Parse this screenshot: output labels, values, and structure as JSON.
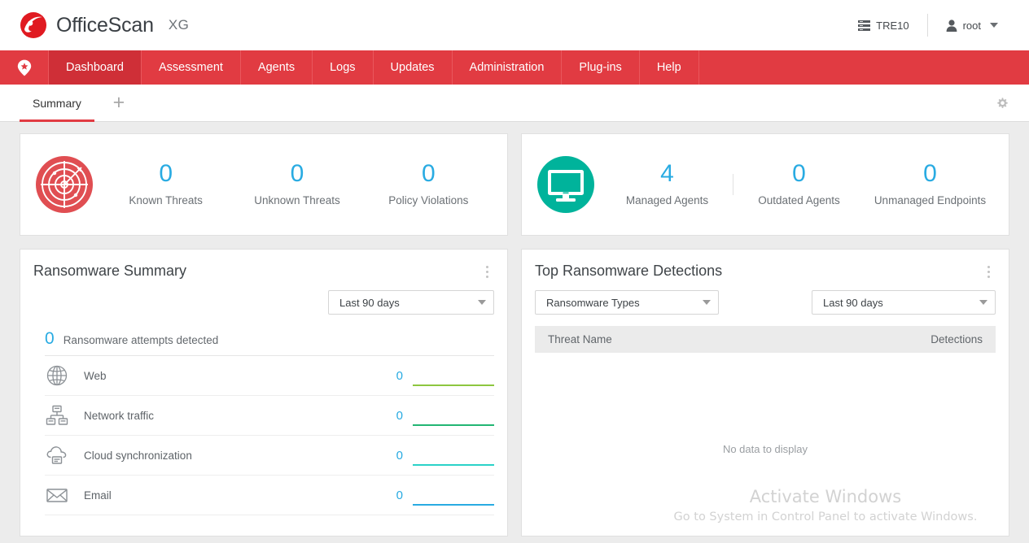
{
  "header": {
    "brand_name": "OfficeScan",
    "brand_suffix": "XG",
    "logo_icon": "trendmicro-swirl-logo",
    "server_icon": "server-stack-icon",
    "server_label": "TRE10",
    "user_icon": "person-icon",
    "user_label": "root",
    "user_caret_icon": "chevron-down-icon"
  },
  "nav": {
    "home_icon": "map-pin-star-icon",
    "items": [
      {
        "label": "Dashboard",
        "active": true
      },
      {
        "label": "Assessment",
        "active": false
      },
      {
        "label": "Agents",
        "active": false
      },
      {
        "label": "Logs",
        "active": false
      },
      {
        "label": "Updates",
        "active": false
      },
      {
        "label": "Administration",
        "active": false
      },
      {
        "label": "Plug-ins",
        "active": false
      },
      {
        "label": "Help",
        "active": false
      }
    ],
    "bg_color": "#e13b42",
    "active_bg_color": "#cf2f37"
  },
  "tabbar": {
    "tabs": [
      {
        "label": "Summary",
        "active": true
      }
    ],
    "add_tab_label": "+",
    "add_tab_icon": "plus-icon",
    "settings_icon": "gear-icon"
  },
  "summary_cards": [
    {
      "badge_icon": "radar-threat-icon",
      "badge_color": "#e04e52",
      "stats": [
        {
          "value": "0",
          "label": "Known Threats",
          "divider_after": false
        },
        {
          "value": "0",
          "label": "Unknown Threats",
          "divider_after": false
        },
        {
          "value": "0",
          "label": "Policy Violations",
          "divider_after": false
        }
      ]
    },
    {
      "badge_icon": "desktop-monitor-icon",
      "badge_color": "#00b39b",
      "stats": [
        {
          "value": "4",
          "label": "Managed Agents",
          "divider_after": true
        },
        {
          "value": "0",
          "label": "Outdated Agents",
          "divider_after": false
        },
        {
          "value": "0",
          "label": "Unmanaged Endpoints",
          "divider_after": false
        }
      ]
    }
  ],
  "ransomware_summary": {
    "title": "Ransomware Summary",
    "menu_icon": "kebab-menu-icon",
    "range_dropdown": {
      "value": "Last 90 days",
      "caret_icon": "caret-down-icon"
    },
    "total_value": "0",
    "total_label": "Ransomware attempts detected",
    "rows": [
      {
        "icon": "globe-icon",
        "label": "Web",
        "value": "0",
        "bar_color": "#8dc63f"
      },
      {
        "icon": "network-icon",
        "label": "Network traffic",
        "value": "0",
        "bar_color": "#22b573"
      },
      {
        "icon": "cloud-sync-icon",
        "label": "Cloud synchronization",
        "value": "0",
        "bar_color": "#2bd2c8"
      },
      {
        "icon": "envelope-icon",
        "label": "Email",
        "value": "0",
        "bar_color": "#29abe2"
      }
    ]
  },
  "top_detections": {
    "title": "Top Ransomware Detections",
    "menu_icon": "kebab-menu-icon",
    "type_dropdown": {
      "value": "Ransomware Types",
      "caret_icon": "caret-down-icon"
    },
    "range_dropdown": {
      "value": "Last 90 days",
      "caret_icon": "caret-down-icon"
    },
    "columns": {
      "threat_name": "Threat Name",
      "detections": "Detections"
    },
    "rows": [],
    "empty_message": "No data to display"
  },
  "watermark": {
    "line1": "Activate Windows",
    "line2": "Go to System in Control Panel to activate Windows."
  },
  "colors": {
    "accent_blue": "#29abe2",
    "brand_red": "#e13b42",
    "teal": "#00b39b",
    "page_bg": "#ececec"
  }
}
